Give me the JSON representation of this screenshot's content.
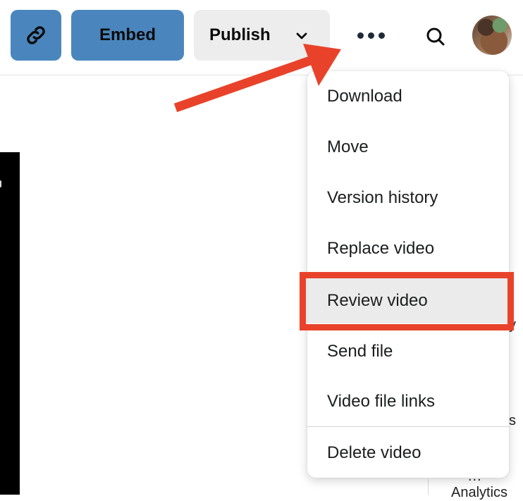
{
  "toolbar": {
    "link_icon": "link-icon",
    "embed_label": "Embed",
    "publish_label": "Publish",
    "publish_icon": "chevron-down-icon",
    "more_icon": "more-horizontal-icon",
    "search_icon": "search-icon",
    "avatar_alt": "user avatar",
    "accent_color": "#4a86bd"
  },
  "menu": {
    "items": [
      {
        "label": "Download"
      },
      {
        "label": "Move"
      },
      {
        "label": "Version history"
      },
      {
        "label": "Replace video"
      },
      {
        "label": "Review video",
        "highlighted": true
      },
      {
        "label": "Send file"
      },
      {
        "label": "Video file links"
      },
      {
        "label": "Delete video"
      }
    ]
  },
  "annotations": {
    "highlight_color": "#e8432a",
    "arrow_target": "more-options-button",
    "highlighted_item": "Review video"
  },
  "background": {
    "partial_texts": [
      "y",
      "s",
      "...",
      "Analytics"
    ]
  }
}
